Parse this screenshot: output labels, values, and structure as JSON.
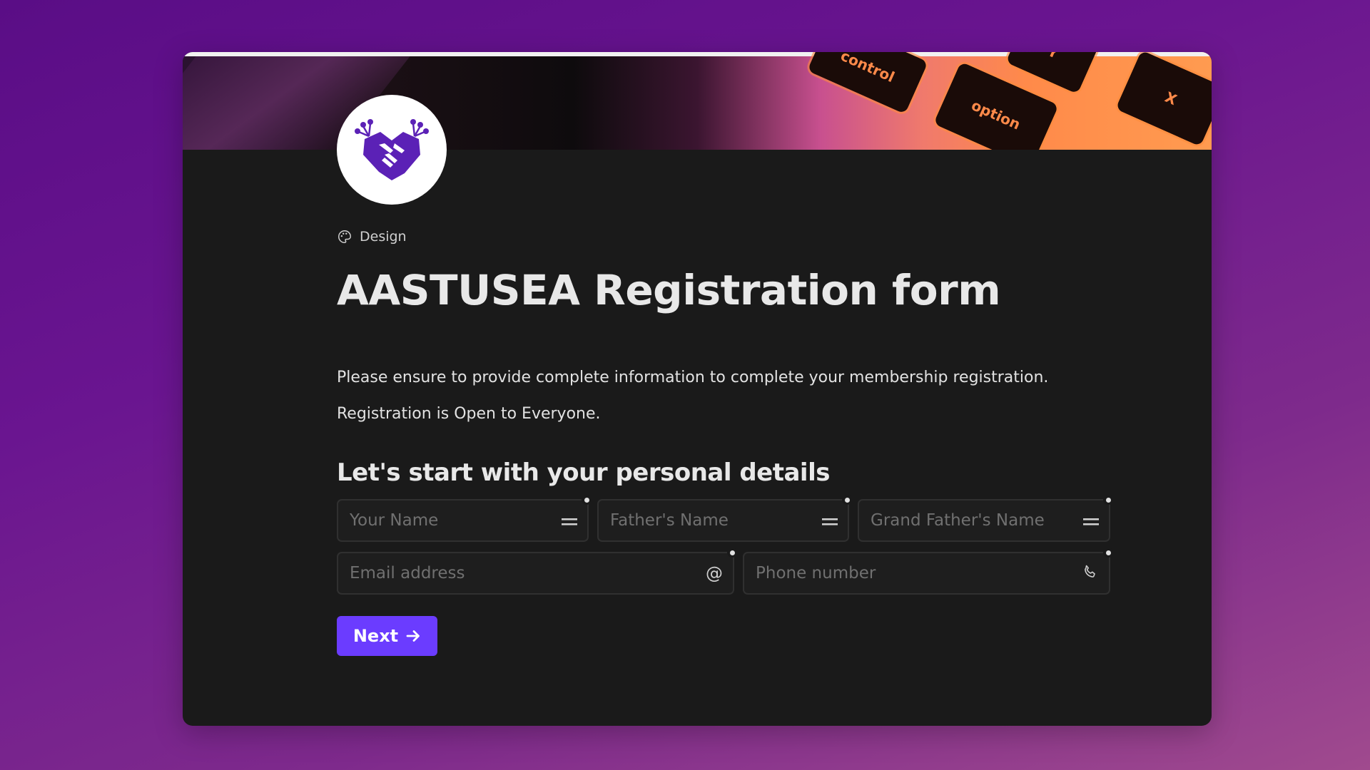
{
  "form": {
    "category": "Design",
    "category_icon": "palette-icon",
    "title": "AASTUSEA Registration form",
    "description": "Please ensure to provide complete information to complete your membership registration.",
    "note": "Registration is Open to Everyone.",
    "section_title": "Let's start with your personal details",
    "fields": {
      "your_name": {
        "placeholder": "Your Name",
        "icon": "equals-icon"
      },
      "fathers_name": {
        "placeholder": "Father's Name",
        "icon": "equals-icon"
      },
      "grandfathers_name": {
        "placeholder": "Grand Father's Name",
        "icon": "equals-icon"
      },
      "email": {
        "placeholder": "Email address",
        "icon": "at-icon"
      },
      "phone": {
        "placeholder": "Phone number",
        "icon": "phone-icon"
      }
    },
    "next_label": "Next"
  },
  "cover": {
    "keys": [
      "control",
      "option",
      "Y",
      "X"
    ]
  },
  "colors": {
    "background": "#6a1590",
    "card": "#1a1a1a",
    "accent": "#6b3cff",
    "logo_purple": "#5b21b6"
  }
}
